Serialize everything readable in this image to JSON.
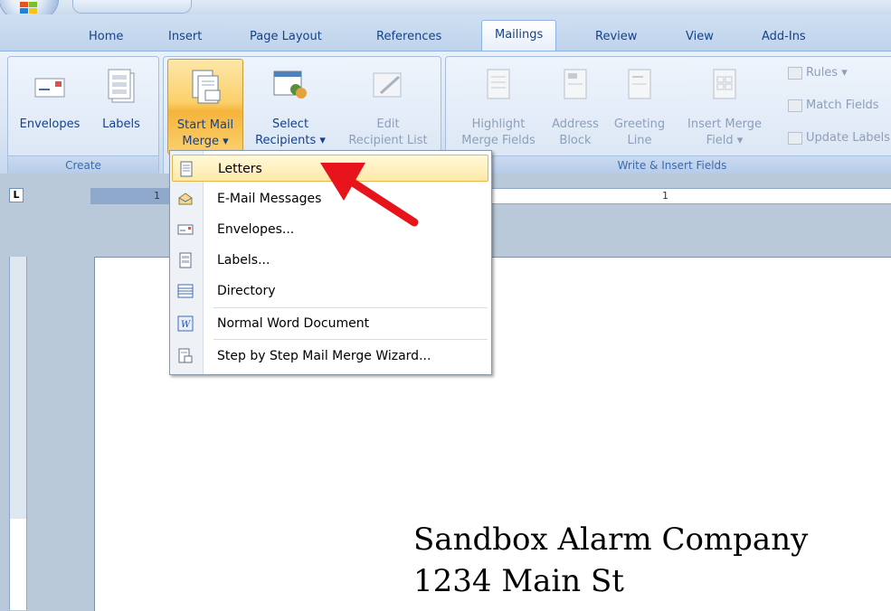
{
  "tabs": [
    {
      "label": "Home",
      "active": false
    },
    {
      "label": "Insert",
      "active": false
    },
    {
      "label": "Page Layout",
      "active": false
    },
    {
      "label": "References",
      "active": false
    },
    {
      "label": "Mailings",
      "active": true
    },
    {
      "label": "Review",
      "active": false
    },
    {
      "label": "View",
      "active": false
    },
    {
      "label": "Add-Ins",
      "active": false
    }
  ],
  "ribbon": {
    "create": {
      "label": "Create",
      "envelopes": "Envelopes",
      "labels": "Labels"
    },
    "start": {
      "start_mail_merge_1": "Start Mail",
      "start_mail_merge_2": "Merge ▾",
      "select_recipients_1": "Select",
      "select_recipients_2": "Recipients ▾",
      "edit_list_1": "Edit",
      "edit_list_2": "Recipient List"
    },
    "write": {
      "label": "Write & Insert Fields",
      "highlight_1": "Highlight",
      "highlight_2": "Merge Fields",
      "address_1": "Address",
      "address_2": "Block",
      "greeting_1": "Greeting",
      "greeting_2": "Line",
      "insert_field_1": "Insert Merge",
      "insert_field_2": "Field ▾",
      "rules": "Rules ▾",
      "match_fields": "Match Fields",
      "update_labels": "Update Labels"
    }
  },
  "ruler": {
    "tab_selector": "L",
    "mark_left": "1",
    "mark_right": "1"
  },
  "menu": {
    "items": [
      {
        "label": "Letters",
        "icon": "letter-icon",
        "selected": true
      },
      {
        "label": "E-Mail Messages",
        "icon": "email-icon",
        "selected": false
      },
      {
        "label": "Envelopes...",
        "icon": "envelope-icon",
        "selected": false
      },
      {
        "label": "Labels...",
        "icon": "labels-icon",
        "selected": false
      },
      {
        "label": "Directory",
        "icon": "directory-icon",
        "selected": false
      },
      {
        "label": "Normal Word Document",
        "icon": "word-doc-icon",
        "selected": false
      },
      {
        "label": "Step by Step Mail Merge Wizard...",
        "icon": "wizard-icon",
        "selected": false
      }
    ]
  },
  "document": {
    "line1": "Sandbox Alarm Company",
    "line2": "1234 Main St"
  },
  "colors": {
    "ribbon_text": "#15428b",
    "highlight": "#fbd06b",
    "arrow": "#e8141b"
  }
}
